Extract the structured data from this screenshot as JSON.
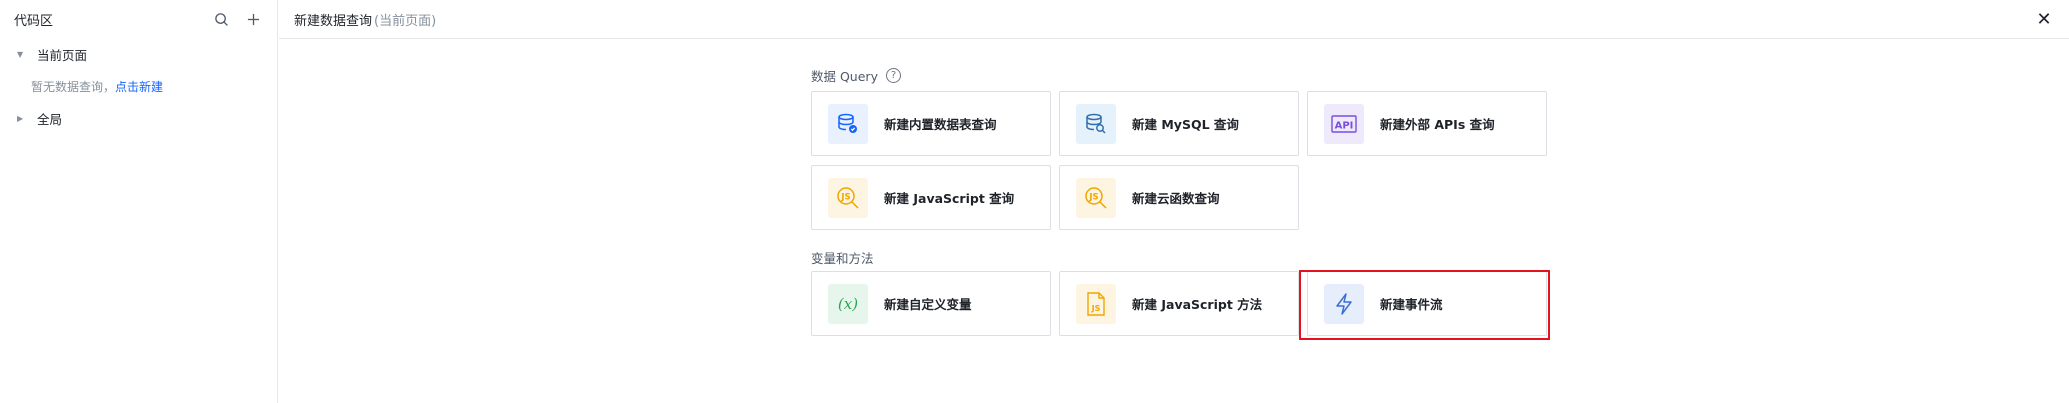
{
  "sidebar": {
    "title": "代码区",
    "tree": {
      "current_page": "当前页面",
      "empty_text": "暂无数据查询，",
      "empty_link": "点击新建",
      "global": "全局"
    }
  },
  "header": {
    "title": "新建数据查询",
    "subtitle": "(当前页面)"
  },
  "sections": {
    "query_label": "数据 Query",
    "vars_label": "变量和方法"
  },
  "cards": {
    "builtin_db": {
      "label": "新建内置数据表查询",
      "icon": "database-icon",
      "bg": "#e8f1fd",
      "color": "#1664ff"
    },
    "mysql": {
      "label": "新建 MySQL 查询",
      "icon": "mysql-database-icon",
      "bg": "#e6f2fb",
      "color": "#2f6fae"
    },
    "external_api": {
      "label": "新建外部 APIs 查询",
      "icon": "api-icon",
      "bg": "#efe9fc",
      "color": "#7b4ddb"
    },
    "js_query": {
      "label": "新建 JavaScript 查询",
      "icon": "javascript-search-icon",
      "bg": "#fdf5e1",
      "color": "#f0a500"
    },
    "cloud_func": {
      "label": "新建云函数查询",
      "icon": "cloud-function-search-icon",
      "bg": "#fdf5e1",
      "color": "#f0a500"
    },
    "custom_var": {
      "label": "新建自定义变量",
      "icon": "variable-icon",
      "bg": "#e7f6ec",
      "color": "#2ea44f"
    },
    "js_method": {
      "label": "新建 JavaScript 方法",
      "icon": "javascript-file-icon",
      "bg": "#fdf5e1",
      "color": "#f0a500"
    },
    "event_flow": {
      "label": "新建事件流",
      "icon": "lightning-icon",
      "bg": "#e6eefc",
      "color": "#3b6fd6"
    }
  }
}
